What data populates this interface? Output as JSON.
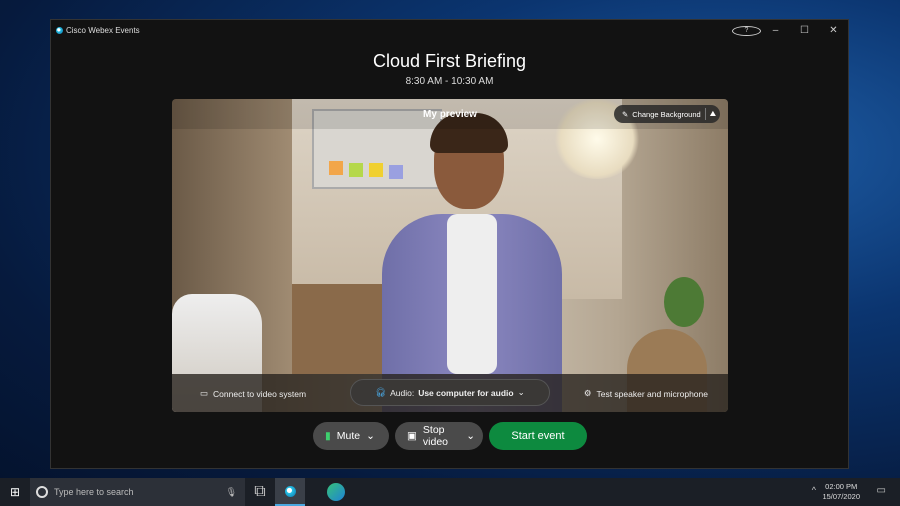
{
  "window": {
    "app_title": "Cisco Webex Events",
    "help": "?",
    "minimize": "–",
    "maximize": "☐",
    "close": "✕"
  },
  "event": {
    "title": "Cloud First Briefing",
    "time": "8:30 AM - 10:30 AM"
  },
  "preview": {
    "label": "My preview",
    "change_background": "Change Background"
  },
  "bottom_bar": {
    "connect": "Connect to video system",
    "audio_prefix": "Audio:",
    "audio_value": "Use computer for audio",
    "test": "Test speaker and microphone"
  },
  "controls": {
    "mute": "Mute",
    "stop_video": "Stop video",
    "start": "Start event"
  },
  "taskbar": {
    "search_placeholder": "Type here to search",
    "time": "02:00 PM",
    "date": "15/07/2020"
  }
}
